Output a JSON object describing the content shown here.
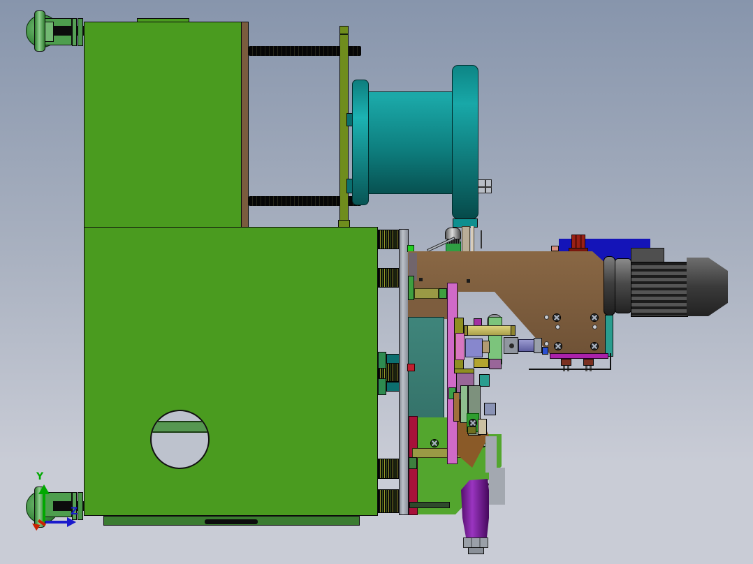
{
  "viewport": {
    "triad": {
      "y_label": "Y",
      "z_label": "Z"
    }
  },
  "palette": {
    "bg-top": "#8795ac",
    "bg-mid": "#a9b1c0",
    "bg-bottom": "#c9ccd6",
    "frame-green": "#4a9b1f",
    "frame-green-dark": "#3b7c31",
    "band-green": "#569751",
    "brown-face": "#7a5c3e",
    "olive-plate": "#6f8d1d",
    "olive-bar": "#9a9a45",
    "olive-block": "#8f8f22",
    "teal-hi": "#1cb3b3",
    "teal-mid": "#0e8080",
    "teal-dark": "#075151",
    "teal-strip": "#2a9d8f",
    "teal-panel": "#3f857b",
    "gray-plate-hi": "#bcc1c9",
    "gray-plate-lo": "#8a8f98",
    "arm-brown": "#7d5d3e",
    "housing-blue": "#1414b8",
    "cap-red": "#8c1d12",
    "motor-mid": "#4f4f4f",
    "motor-dark": "#1c1c1c",
    "motor-lite": "#6e6e6e",
    "pink-plate": "#d06ac8",
    "magenta-bar": "#aa22aa",
    "crimson": "#a8123a",
    "bracket-green": "#53a62e",
    "purple-hi": "#9a35c0",
    "purple-lo": "#55106e",
    "yellow-rod": "#d0c66a",
    "steel-rod": "#7b7bbd",
    "lavender": "#8787cd",
    "plum": "#996699",
    "ltgreen": "#8fbf8f",
    "graygreen": "#7d917d",
    "bluegray": "#8a93b5",
    "foot-green": "#4e9e4e",
    "foot-green-hi": "#8ecf8e",
    "spring-fleck": "#9a9a2a",
    "nut-gray": "#9aa0a8",
    "salmon": "#d9917e",
    "chip-green": "#24cf24",
    "red-chip": "#c01f30",
    "tan": "#b29a72",
    "wedge-brown": "#8a5a28",
    "beige": "#cbc1a2",
    "mustard": "#b3a52f",
    "blue-chip": "#2a4fd0",
    "dkgreen-chip": "#3e7f3e",
    "triad-green": "#00a800",
    "triad-blue": "#1a1acc",
    "triad-red": "#cc2200"
  },
  "parts": [
    {
      "name": "base-frame",
      "color": "#4a9b1f"
    },
    {
      "name": "frame-side-face",
      "color": "#7a5c3e"
    },
    {
      "name": "leveling-foot-top",
      "color": "#4e9e4e"
    },
    {
      "name": "leveling-foot-bottom",
      "color": "#4e9e4e"
    },
    {
      "name": "threaded-rod-upper",
      "color": "#0b0b0b"
    },
    {
      "name": "threaded-rod-middle",
      "color": "#0b0b0b"
    },
    {
      "name": "mount-plate",
      "color": "#6f8d1d"
    },
    {
      "name": "cable-drum",
      "color": "#0e8080"
    },
    {
      "name": "slide-plate",
      "color": "#9aa0a8"
    },
    {
      "name": "compression-springs",
      "color": "#9a9a2a"
    },
    {
      "name": "arm-plate",
      "color": "#7d5d3e"
    },
    {
      "name": "motor-housing",
      "color": "#1414b8"
    },
    {
      "name": "gear-motor",
      "color": "#4f4f4f"
    },
    {
      "name": "pink-guide-plate",
      "color": "#d06ac8"
    },
    {
      "name": "teal-panel",
      "color": "#3f857b"
    },
    {
      "name": "lower-bracket",
      "color": "#53a62e"
    },
    {
      "name": "crimson-rail",
      "color": "#a8123a"
    },
    {
      "name": "cylinder-body",
      "color": "#7c1f9f"
    },
    {
      "name": "yellow-pin",
      "color": "#d0c66a"
    },
    {
      "name": "piston-rod",
      "color": "#7b7bbd"
    }
  ]
}
